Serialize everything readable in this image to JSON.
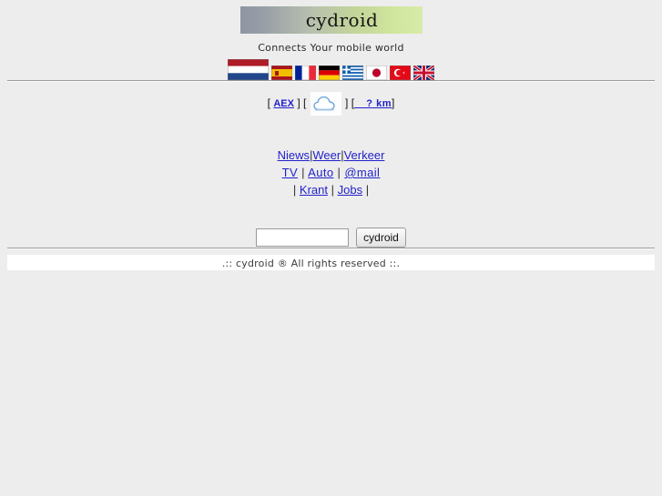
{
  "site": {
    "logo_text": "cydroid",
    "tagline": "Connects Your mobile world"
  },
  "languages": [
    {
      "name": "Netherlands",
      "icon": "flag-nl-icon",
      "code": "nl"
    },
    {
      "name": "Spain",
      "icon": "flag-es-icon",
      "code": "es"
    },
    {
      "name": "France",
      "icon": "flag-fr-icon",
      "code": "fr"
    },
    {
      "name": "Germany",
      "icon": "flag-de-icon",
      "code": "de"
    },
    {
      "name": "Greece",
      "icon": "flag-gr-icon",
      "code": "gr"
    },
    {
      "name": "Japan",
      "icon": "flag-jp-icon",
      "code": "jp"
    },
    {
      "name": "Turkey",
      "icon": "flag-tr-icon",
      "code": "tr"
    },
    {
      "name": "United Kingdom",
      "icon": "flag-gb-icon",
      "code": "gb"
    }
  ],
  "status": {
    "open_bracket": "[",
    "close_bracket": "]",
    "stock_label": "AEX",
    "weather_icon": "cloud-icon",
    "distance_label": "__? km"
  },
  "nav": {
    "rows": [
      {
        "prefix": "",
        "items": [
          "Niews",
          "Weer",
          "Verkeer"
        ],
        "suffix": "",
        "separator": "|"
      },
      {
        "prefix": "",
        "items": [
          "TV",
          "Auto",
          "@mail"
        ],
        "suffix": "",
        "separator": "|"
      },
      {
        "prefix": "|",
        "items": [
          "Krant",
          "Jobs"
        ],
        "suffix": "|",
        "separator": "|"
      }
    ]
  },
  "search": {
    "value": "",
    "placeholder": "",
    "button_label": "cydroid"
  },
  "footer": {
    "text": ".:: cydroid ® All rights reserved ::."
  },
  "colors": {
    "page_background": "#ededed",
    "link": "#2222cc",
    "banner_start": "#8f95a3",
    "banner_end": "#d8ecaa",
    "footer_band": "#ffffff"
  }
}
